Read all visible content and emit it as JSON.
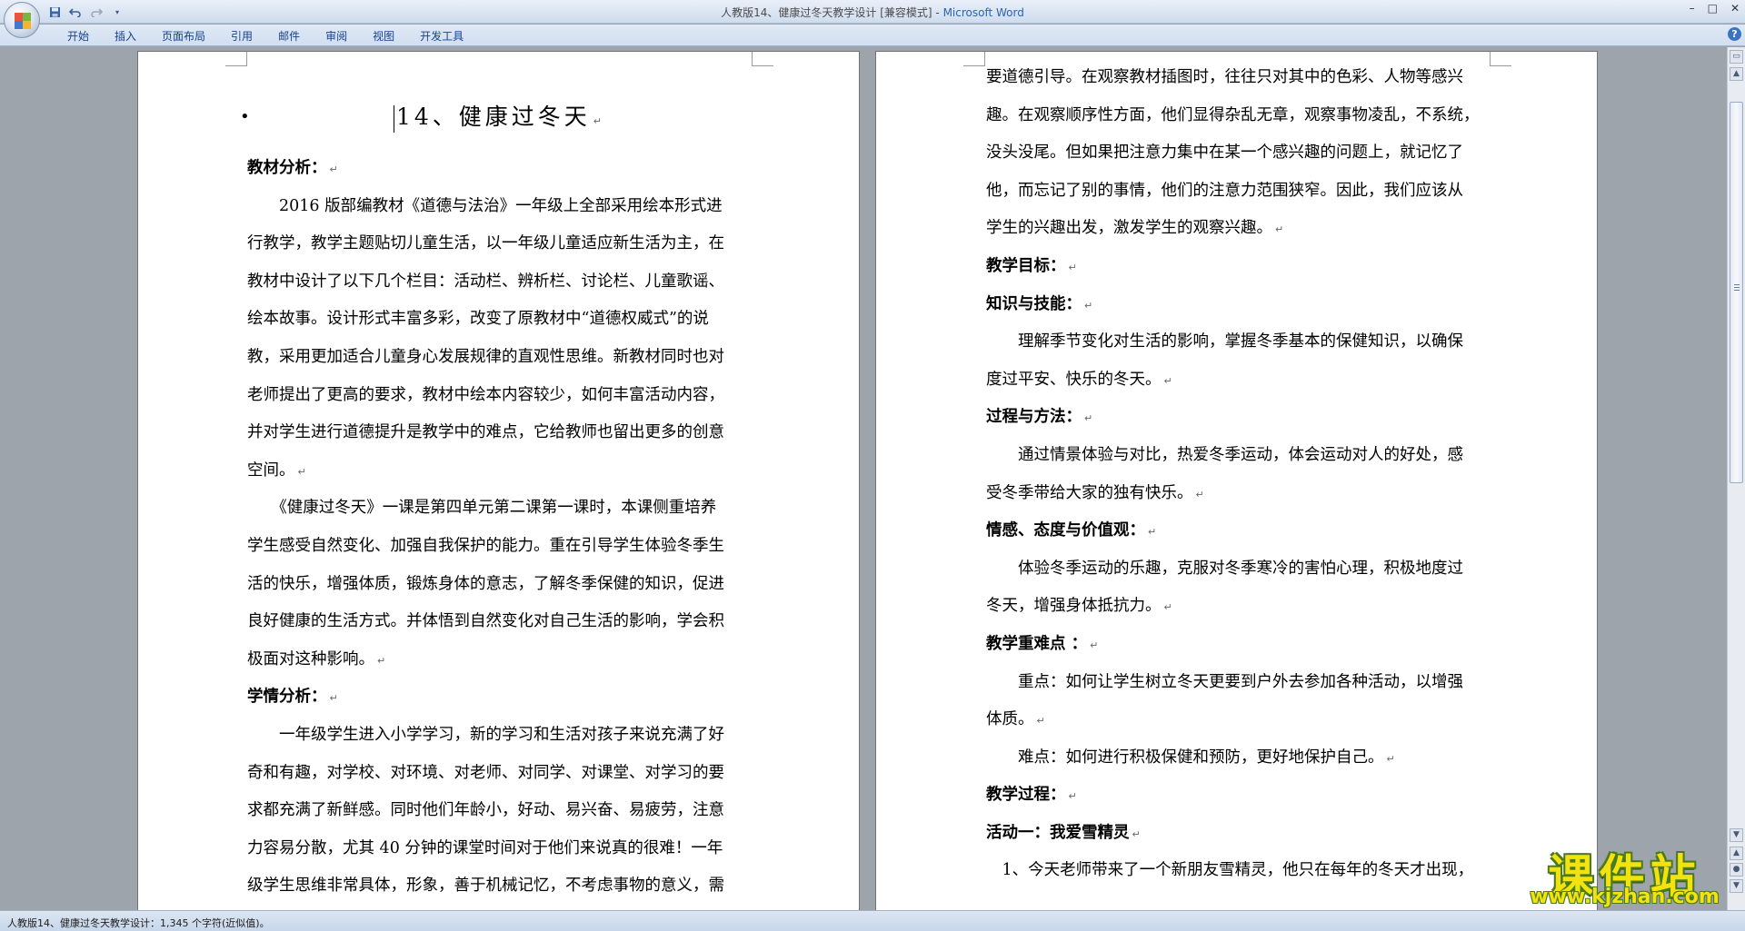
{
  "window": {
    "title": "人教版14、健康过冬天教学设计 [兼容模式]",
    "app_name": "Microsoft Word",
    "controls": {
      "minimize": "–",
      "maximize": "□",
      "close": "✕"
    }
  },
  "quick_access": {
    "save_icon": "save-icon",
    "undo_icon": "undo-icon",
    "redo_icon": "redo-icon",
    "customize_icon": "dropdown-icon"
  },
  "ribbon": {
    "tabs": [
      "开始",
      "插入",
      "页面布局",
      "引用",
      "邮件",
      "审阅",
      "视图",
      "开发工具"
    ],
    "help": "?"
  },
  "doc": {
    "title_bullet": "•",
    "title": "14、健康过冬天",
    "left_lines": [
      {
        "text": "教材分析：",
        "bold": true
      },
      {
        "text": "　　2016 版部编教材《道德与法治》一年级上全部采用绘本形式进",
        "bold": false
      },
      {
        "text": "行教学，教学主题贴切儿童生活，以一年级儿童适应新生活为主，在",
        "bold": false
      },
      {
        "text": "教材中设计了以下几个栏目：活动栏、辨析栏、讨论栏、儿童歌谣、",
        "bold": false
      },
      {
        "text": "绘本故事。设计形式丰富多彩，改变了原教材中“道德权威式”的说",
        "bold": false
      },
      {
        "text": "教，采用更加适合儿童身心发展规律的直观性思维。新教材同时也对",
        "bold": false
      },
      {
        "text": "老师提出了更高的要求，教材中绘本内容较少，如何丰富活动内容，",
        "bold": false
      },
      {
        "text": "并对学生进行道德提升是教学中的难点，它给教师也留出更多的创意",
        "bold": false
      },
      {
        "text": "空间。",
        "bold": false
      },
      {
        "text": "　　《健康过冬天》一课是第四单元第二课第一课时，本课侧重培养",
        "bold": false
      },
      {
        "text": "学生感受自然变化、加强自我保护的能力。重在引导学生体验冬季生",
        "bold": false
      },
      {
        "text": "活的快乐，增强体质，锻炼身体的意志，了解冬季保健的知识，促进",
        "bold": false
      },
      {
        "text": "良好健康的生活方式。并体悟到自然变化对自己生活的影响，学会积",
        "bold": false
      },
      {
        "text": "极面对这种影响。",
        "bold": false
      },
      {
        "text": "学情分析：",
        "bold": true
      },
      {
        "text": "　　一年级学生进入小学学习，新的学习和生活对孩子来说充满了好",
        "bold": false
      },
      {
        "text": "奇和有趣，对学校、对环境、对老师、对同学、对课堂、对学习的要",
        "bold": false
      },
      {
        "text": "求都充满了新鲜感。同时他们年龄小，好动、易兴奋、易疲劳，注意",
        "bold": false
      },
      {
        "text": "力容易分散，尤其 40 分钟的课堂时间对于他们来说真的很难！一年",
        "bold": false
      },
      {
        "text": "级学生思维非常具体，形象，善于机械记忆，不考虑事物的意义，需",
        "bold": false
      }
    ],
    "right_lines": [
      {
        "text": "要道德引导。在观察教材插图时，往往只对其中的色彩、人物等感兴",
        "bold": false,
        "mark": false
      },
      {
        "text": "趣。在观察顺序性方面，他们显得杂乱无章，观察事物凌乱，不系统，",
        "bold": false,
        "mark": false
      },
      {
        "text": "没头没尾。但如果把注意力集中在某一个感兴趣的问题上，就记忆了",
        "bold": false,
        "mark": false
      },
      {
        "text": "他，而忘记了别的事情，他们的注意力范围狭窄。因此，我们应该从",
        "bold": false,
        "mark": false
      },
      {
        "text": "学生的兴趣出发，激发学生的观察兴趣。",
        "bold": false,
        "mark": true
      },
      {
        "text": "教学目标：",
        "bold": true,
        "mark": true
      },
      {
        "text": "知识与技能：",
        "bold": true,
        "mark": true
      },
      {
        "text": "　　理解季节变化对生活的影响，掌握冬季基本的保健知识，以确保",
        "bold": false,
        "mark": false
      },
      {
        "text": "度过平安、快乐的冬天。",
        "bold": false,
        "mark": true
      },
      {
        "text": "过程与方法：",
        "bold": true,
        "mark": true
      },
      {
        "text": "　　通过情景体验与对比，热爱冬季运动，体会运动对人的好处，感",
        "bold": false,
        "mark": false
      },
      {
        "text": "受冬季带给大家的独有快乐。",
        "bold": false,
        "mark": true
      },
      {
        "text": "情感、态度与价值观：",
        "bold": true,
        "mark": true
      },
      {
        "text": "　　体验冬季运动的乐趣，克服对冬季寒冷的害怕心理，积极地度过",
        "bold": false,
        "mark": false
      },
      {
        "text": "冬天，增强身体抵抗力。",
        "bold": false,
        "mark": true
      },
      {
        "text": "教学重难点 ：",
        "bold": true,
        "mark": true
      },
      {
        "text": "　　重点：如何让学生树立冬天更要到户外去参加各种活动，以增强",
        "bold": false,
        "mark": false
      },
      {
        "text": "体质。",
        "bold": false,
        "mark": true
      },
      {
        "text": "　　难点：如何进行积极保健和预防，更好地保护自己。",
        "bold": false,
        "mark": true
      },
      {
        "text": "教学过程：",
        "bold": true,
        "mark": true
      },
      {
        "text": "活动一：我爱雪精灵",
        "bold": true,
        "mark": true
      },
      {
        "text": "　1、今天老师带来了一个新朋友雪精灵，他只在每年的冬天才出现，",
        "bold": false,
        "mark": false
      }
    ],
    "para_mark": "↵"
  },
  "status": {
    "text": "人教版14、健康过冬天教学设计：1,345 个字符(近似值)。"
  },
  "watermark": {
    "main": "课件站",
    "url": "www.kjzhan.com"
  },
  "colors": {
    "title_bar": "#dfe9f6",
    "app_name": "#2a63b8",
    "watermark": "#f2e210"
  }
}
